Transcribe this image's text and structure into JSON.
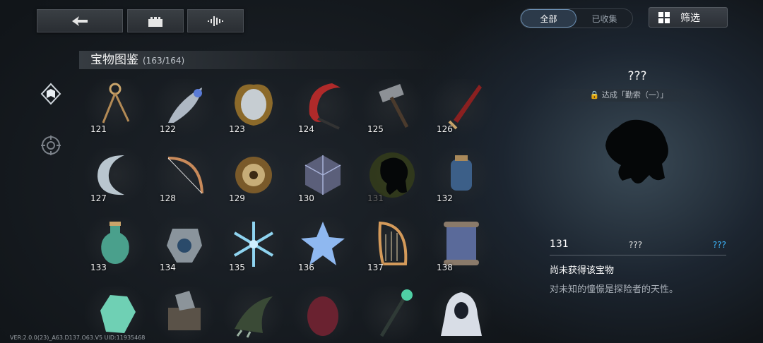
{
  "toolbar": {
    "back_icon": "back-arrow-icon",
    "castle_icon": "castle-icon",
    "sound_icon": "sound-wave-icon"
  },
  "tabs": {
    "all": "全部",
    "collected": "已收集"
  },
  "filter": {
    "label": "筛选",
    "icon": "grid-icon"
  },
  "collection": {
    "title": "宝物图鉴",
    "count": "(163/164)"
  },
  "side": {
    "item1_icon": "book-icon",
    "item2_icon": "compass-icon"
  },
  "items": [
    {
      "num": "121",
      "icon": "compass-icon"
    },
    {
      "num": "122",
      "icon": "feather-icon"
    },
    {
      "num": "123",
      "icon": "mirror-icon"
    },
    {
      "num": "124",
      "icon": "scythe-icon"
    },
    {
      "num": "125",
      "icon": "hammer-icon"
    },
    {
      "num": "126",
      "icon": "dagger-icon"
    },
    {
      "num": "127",
      "icon": "moon-icon"
    },
    {
      "num": "128",
      "icon": "bow-icon"
    },
    {
      "num": "129",
      "icon": "gear-disc-icon"
    },
    {
      "num": "130",
      "icon": "crystal-cube-icon"
    },
    {
      "num": "131",
      "icon": "silhouette-icon"
    },
    {
      "num": "132",
      "icon": "lantern-icon"
    },
    {
      "num": "133",
      "icon": "potion-icon"
    },
    {
      "num": "134",
      "icon": "amulet-icon"
    },
    {
      "num": "135",
      "icon": "snowflake-icon"
    },
    {
      "num": "136",
      "icon": "star-icon"
    },
    {
      "num": "137",
      "icon": "harp-icon"
    },
    {
      "num": "138",
      "icon": "scroll-icon"
    },
    {
      "num": "",
      "icon": "gem-icon"
    },
    {
      "num": "",
      "icon": "book-stack-icon"
    },
    {
      "num": "",
      "icon": "claw-icon"
    },
    {
      "num": "",
      "icon": "egg-icon"
    },
    {
      "num": "",
      "icon": "staff-icon"
    },
    {
      "num": "",
      "icon": "hooded-figure-icon"
    }
  ],
  "detail": {
    "title": "???",
    "unlock": "达成「勤索（一）」",
    "number": "131",
    "middle": "???",
    "rarity": "???",
    "name": "尚未获得该宝物",
    "description": "对未知的憧憬是探险者的天性。"
  },
  "version": "VER:2.0.0(23)_A63.D137.O63.V5    UID:11935468",
  "colors": {
    "rarity": "#3db8ff",
    "accent": "#6b8fb3"
  }
}
